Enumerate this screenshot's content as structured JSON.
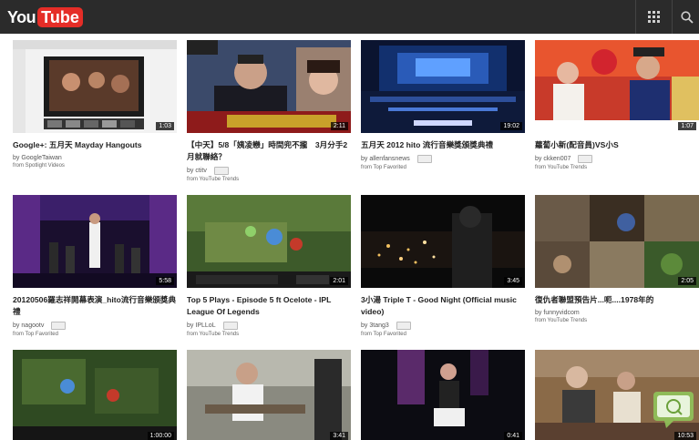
{
  "header": {
    "logo_you": "You",
    "logo_tube": "Tube",
    "icons": [
      "apps-grid-icon",
      "search-icon"
    ]
  },
  "videos": [
    {
      "title": "Google+: 五月天 Mayday Hangouts",
      "by_prefix": "by",
      "channel": "GoogleTaiwan",
      "from": "from Spotlight Videos",
      "duration": "1:03"
    },
    {
      "title": "【中天】5/8「姨凌戀」時間兜不攏　3月分手2月就聯絡？",
      "by_prefix": "by",
      "channel": "ctitv",
      "from": "from YouTube Trends",
      "duration": "2:11"
    },
    {
      "title": "五月天 2012 hito 流行音樂獎頒獎典禮",
      "by_prefix": "by",
      "channel": "allenfansnews",
      "from": "from Top Favorited",
      "duration": "19:02"
    },
    {
      "title": "蘿蔔小新(配音員)VS小S",
      "by_prefix": "by",
      "channel": "ckken007",
      "from": "from YouTube Trends",
      "duration": "1:07"
    },
    {
      "title": "20120506羅志祥開幕表演_hito流行音樂頒獎典禮",
      "by_prefix": "by",
      "channel": "nagootv",
      "from": "from Top Favorited",
      "duration": "5:58"
    },
    {
      "title": "Top 5 Plays - Episode 5 ft Ocelote - IPL League Of Legends",
      "by_prefix": "by",
      "channel": "IPLLoL",
      "from": "from YouTube Trends",
      "duration": "2:01"
    },
    {
      "title": "3小湯 Triple T - Good Night (Official music video)",
      "by_prefix": "by",
      "channel": "3tang3",
      "from": "from Top Favorited",
      "duration": "3:45"
    },
    {
      "title": "復仇者聯盟預告片...呃....1978年的",
      "by_prefix": "by",
      "channel": "funnyvidcom",
      "from": "from YouTube Trends",
      "duration": "2:05"
    },
    {
      "title": "",
      "by_prefix": "",
      "channel": "",
      "from": "",
      "duration": "1:00:00"
    },
    {
      "title": "",
      "by_prefix": "",
      "channel": "",
      "from": "",
      "duration": "3:41"
    },
    {
      "title": "",
      "by_prefix": "",
      "channel": "",
      "from": "",
      "duration": "0:41"
    },
    {
      "title": "",
      "by_prefix": "",
      "channel": "",
      "from": "",
      "duration": "10:53"
    }
  ],
  "colors": {
    "topbar": "#2b2b2b",
    "brand_red": "#e52d27"
  }
}
